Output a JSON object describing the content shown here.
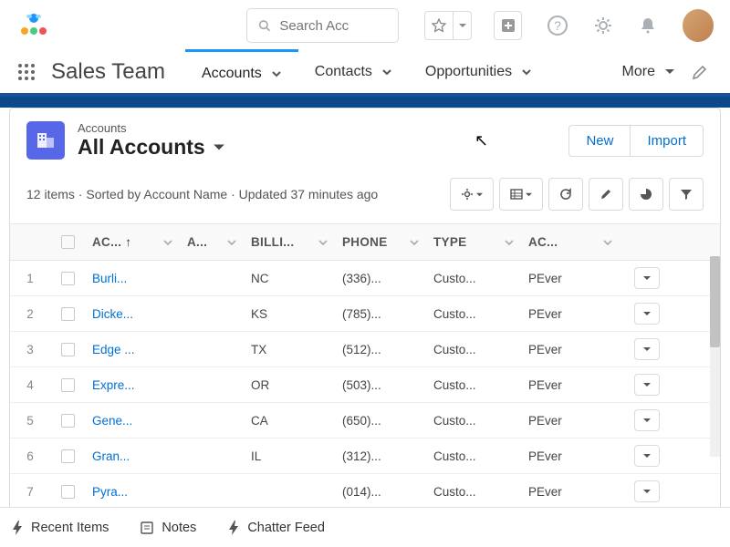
{
  "search": {
    "placeholder": "Search Acc"
  },
  "nav": {
    "app_name": "Sales Team",
    "items": [
      "Accounts",
      "Contacts",
      "Opportunities",
      "More"
    ],
    "active_index": 0
  },
  "header": {
    "entity": "Accounts",
    "title": "All Accounts",
    "new_label": "New",
    "import_label": "Import"
  },
  "listinfo": "12 items · Sorted by Account Name · Updated 37 minutes ago",
  "columns": {
    "name": "AC...",
    "name2": "A...",
    "state": "BILLI...",
    "phone": "PHONE",
    "type": "TYPE",
    "owner": "AC..."
  },
  "rows": [
    {
      "n": "1",
      "name": "Burli...",
      "state": "NC",
      "phone": "(336)...",
      "type": "Custo...",
      "owner": "PEver"
    },
    {
      "n": "2",
      "name": "Dicke...",
      "state": "KS",
      "phone": "(785)...",
      "type": "Custo...",
      "owner": "PEver"
    },
    {
      "n": "3",
      "name": "Edge ...",
      "state": "TX",
      "phone": "(512)...",
      "type": "Custo...",
      "owner": "PEver"
    },
    {
      "n": "4",
      "name": "Expre...",
      "state": "OR",
      "phone": "(503)...",
      "type": "Custo...",
      "owner": "PEver"
    },
    {
      "n": "5",
      "name": "Gene...",
      "state": "CA",
      "phone": "(650)...",
      "type": "Custo...",
      "owner": "PEver"
    },
    {
      "n": "6",
      "name": "Gran...",
      "state": "IL",
      "phone": "(312)...",
      "type": "Custo...",
      "owner": "PEver"
    },
    {
      "n": "7",
      "name": "Pyra...",
      "state": "",
      "phone": "(014)...",
      "type": "Custo...",
      "owner": "PEver"
    }
  ],
  "bottombar": {
    "recent": "Recent Items",
    "notes": "Notes",
    "chatter": "Chatter Feed"
  }
}
